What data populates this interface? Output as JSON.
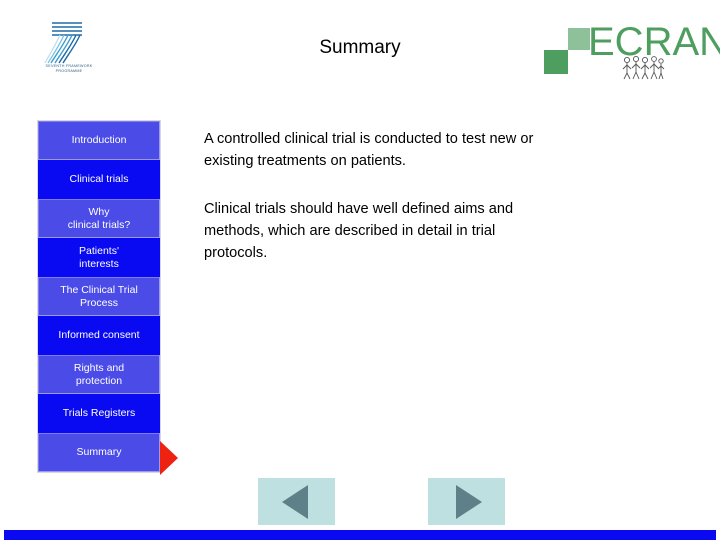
{
  "slide": {
    "title": "Summary"
  },
  "fp7_logo": {
    "name": "fp7-logo",
    "caption_line1": "SEVENTH FRAMEWORK",
    "caption_line2": "PROGRAMME",
    "color": "#2a5d86"
  },
  "ecran_logo": {
    "name": "ecran-logo",
    "wordmark": "ECRAN",
    "color_light": "#8ec19a",
    "color_dark": "#4e9e5f"
  },
  "sidebar": {
    "background": "#0a0af2",
    "active_index": 8,
    "pointer_color": "#ee2211",
    "items": [
      {
        "label": "Introduction",
        "style": "light",
        "name": "sidebar-item-introduction"
      },
      {
        "label": "Clinical trials",
        "style": "dark",
        "name": "sidebar-item-clinical-trials"
      },
      {
        "label": "Why\nclinical trials?",
        "style": "light",
        "name": "sidebar-item-why-clinical-trials"
      },
      {
        "label": "Patients'\ninterests",
        "style": "dark",
        "name": "sidebar-item-patients-interests"
      },
      {
        "label": "The Clinical Trial\nProcess",
        "style": "light",
        "name": "sidebar-item-clinical-trial-process"
      },
      {
        "label": "Informed consent",
        "style": "dark",
        "name": "sidebar-item-informed-consent"
      },
      {
        "label": "Rights and\nprotection",
        "style": "light",
        "name": "sidebar-item-rights-and-protection"
      },
      {
        "label": "Trials Registers",
        "style": "dark",
        "name": "sidebar-item-trials-registers"
      },
      {
        "label": "Summary",
        "style": "light",
        "name": "sidebar-item-summary"
      }
    ]
  },
  "content": {
    "paragraph1": "A controlled clinical trial is conducted to test new or existing treatments on patients.",
    "paragraph2": "Clinical trials should have well defined aims and methods, which are described in detail in trial protocols."
  },
  "navigation": {
    "previous_label": "Previous slide",
    "next_label": "Next slide",
    "button_background": "#bfe0e0",
    "arrow_color": "#5d8089"
  },
  "bottom_bar": {
    "color": "#0a0af2"
  }
}
